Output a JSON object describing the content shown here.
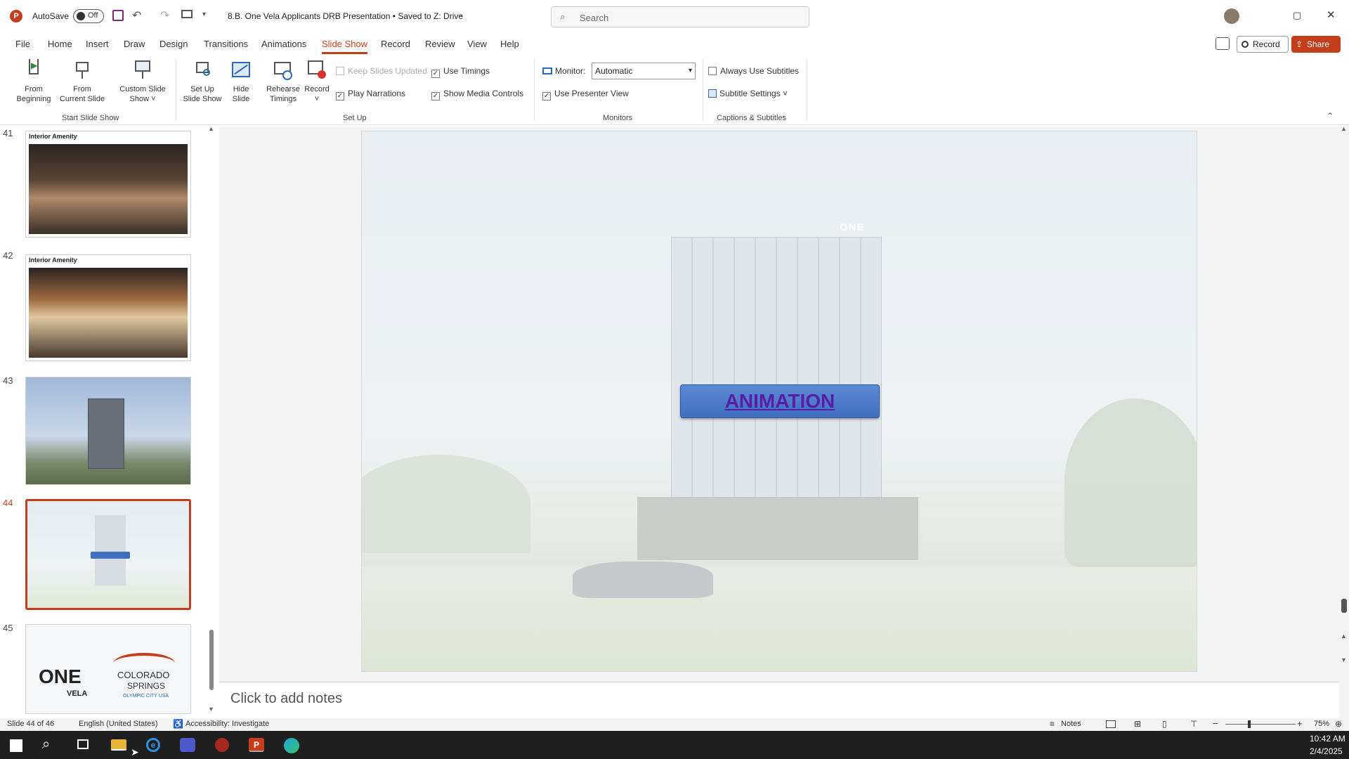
{
  "titlebar": {
    "autosave_label": "AutoSave",
    "autosave_state": "Off",
    "doc_title": "8.B. One Vela Applicants DRB Presentation • Saved to Z: Drive",
    "search_placeholder": "Search"
  },
  "menu": {
    "items": [
      "File",
      "Home",
      "Insert",
      "Draw",
      "Design",
      "Transitions",
      "Animations",
      "Slide Show",
      "Record",
      "Review",
      "View",
      "Help"
    ],
    "active": "Slide Show",
    "record_label": "Record",
    "share_label": "Share"
  },
  "ribbon": {
    "start": {
      "from_beginning": [
        "From",
        "Beginning"
      ],
      "from_current": [
        "From",
        "Current Slide"
      ],
      "custom": [
        "Custom Slide",
        "Show ˅"
      ],
      "group_label": "Start Slide Show"
    },
    "setup": {
      "setup_show": [
        "Set Up",
        "Slide Show"
      ],
      "hide_slide": [
        "Hide",
        "Slide"
      ],
      "rehearse": [
        "Rehearse",
        "Timings"
      ],
      "record": [
        "Record",
        "˅"
      ],
      "keep_updated": "Keep Slides Updated",
      "play_narrations": "Play Narrations",
      "use_timings": "Use Timings",
      "show_media": "Show Media Controls",
      "group_label": "Set Up"
    },
    "monitors": {
      "monitor_label": "Monitor:",
      "monitor_value": "Automatic",
      "presenter_view": "Use Presenter View",
      "group_label": "Monitors"
    },
    "captions": {
      "always_subtitles": "Always Use Subtitles",
      "subtitle_settings": "Subtitle Settings ˅",
      "group_label": "Captions & Subtitles"
    }
  },
  "thumbnails": [
    {
      "num": "41",
      "title": "Interior Amenity"
    },
    {
      "num": "42",
      "title": "Interior Amenity"
    },
    {
      "num": "43",
      "title": ""
    },
    {
      "num": "44",
      "title": ""
    },
    {
      "num": "45",
      "title": ""
    }
  ],
  "slide": {
    "button_label": "ANIMATION",
    "building_sign": "ONE"
  },
  "slide45": {
    "one": "ONE",
    "vela": "VELA",
    "colorado": "COLORADO",
    "springs": "SPRINGS",
    "olympic": "OLYMPIC CITY USA"
  },
  "notes": {
    "placeholder": "Click to add notes"
  },
  "status": {
    "slide_count": "Slide 44 of 46",
    "language": "English (United States)",
    "accessibility": "Accessibility: Investigate",
    "notes_label": "Notes",
    "zoom": "75%"
  },
  "taskbar": {
    "time": "10:42 AM",
    "date": "2/4/2025"
  },
  "colors": {
    "accent": "#c43e1c",
    "button_blue": "#3f6fbf",
    "button_text": "#5a1ea6"
  }
}
